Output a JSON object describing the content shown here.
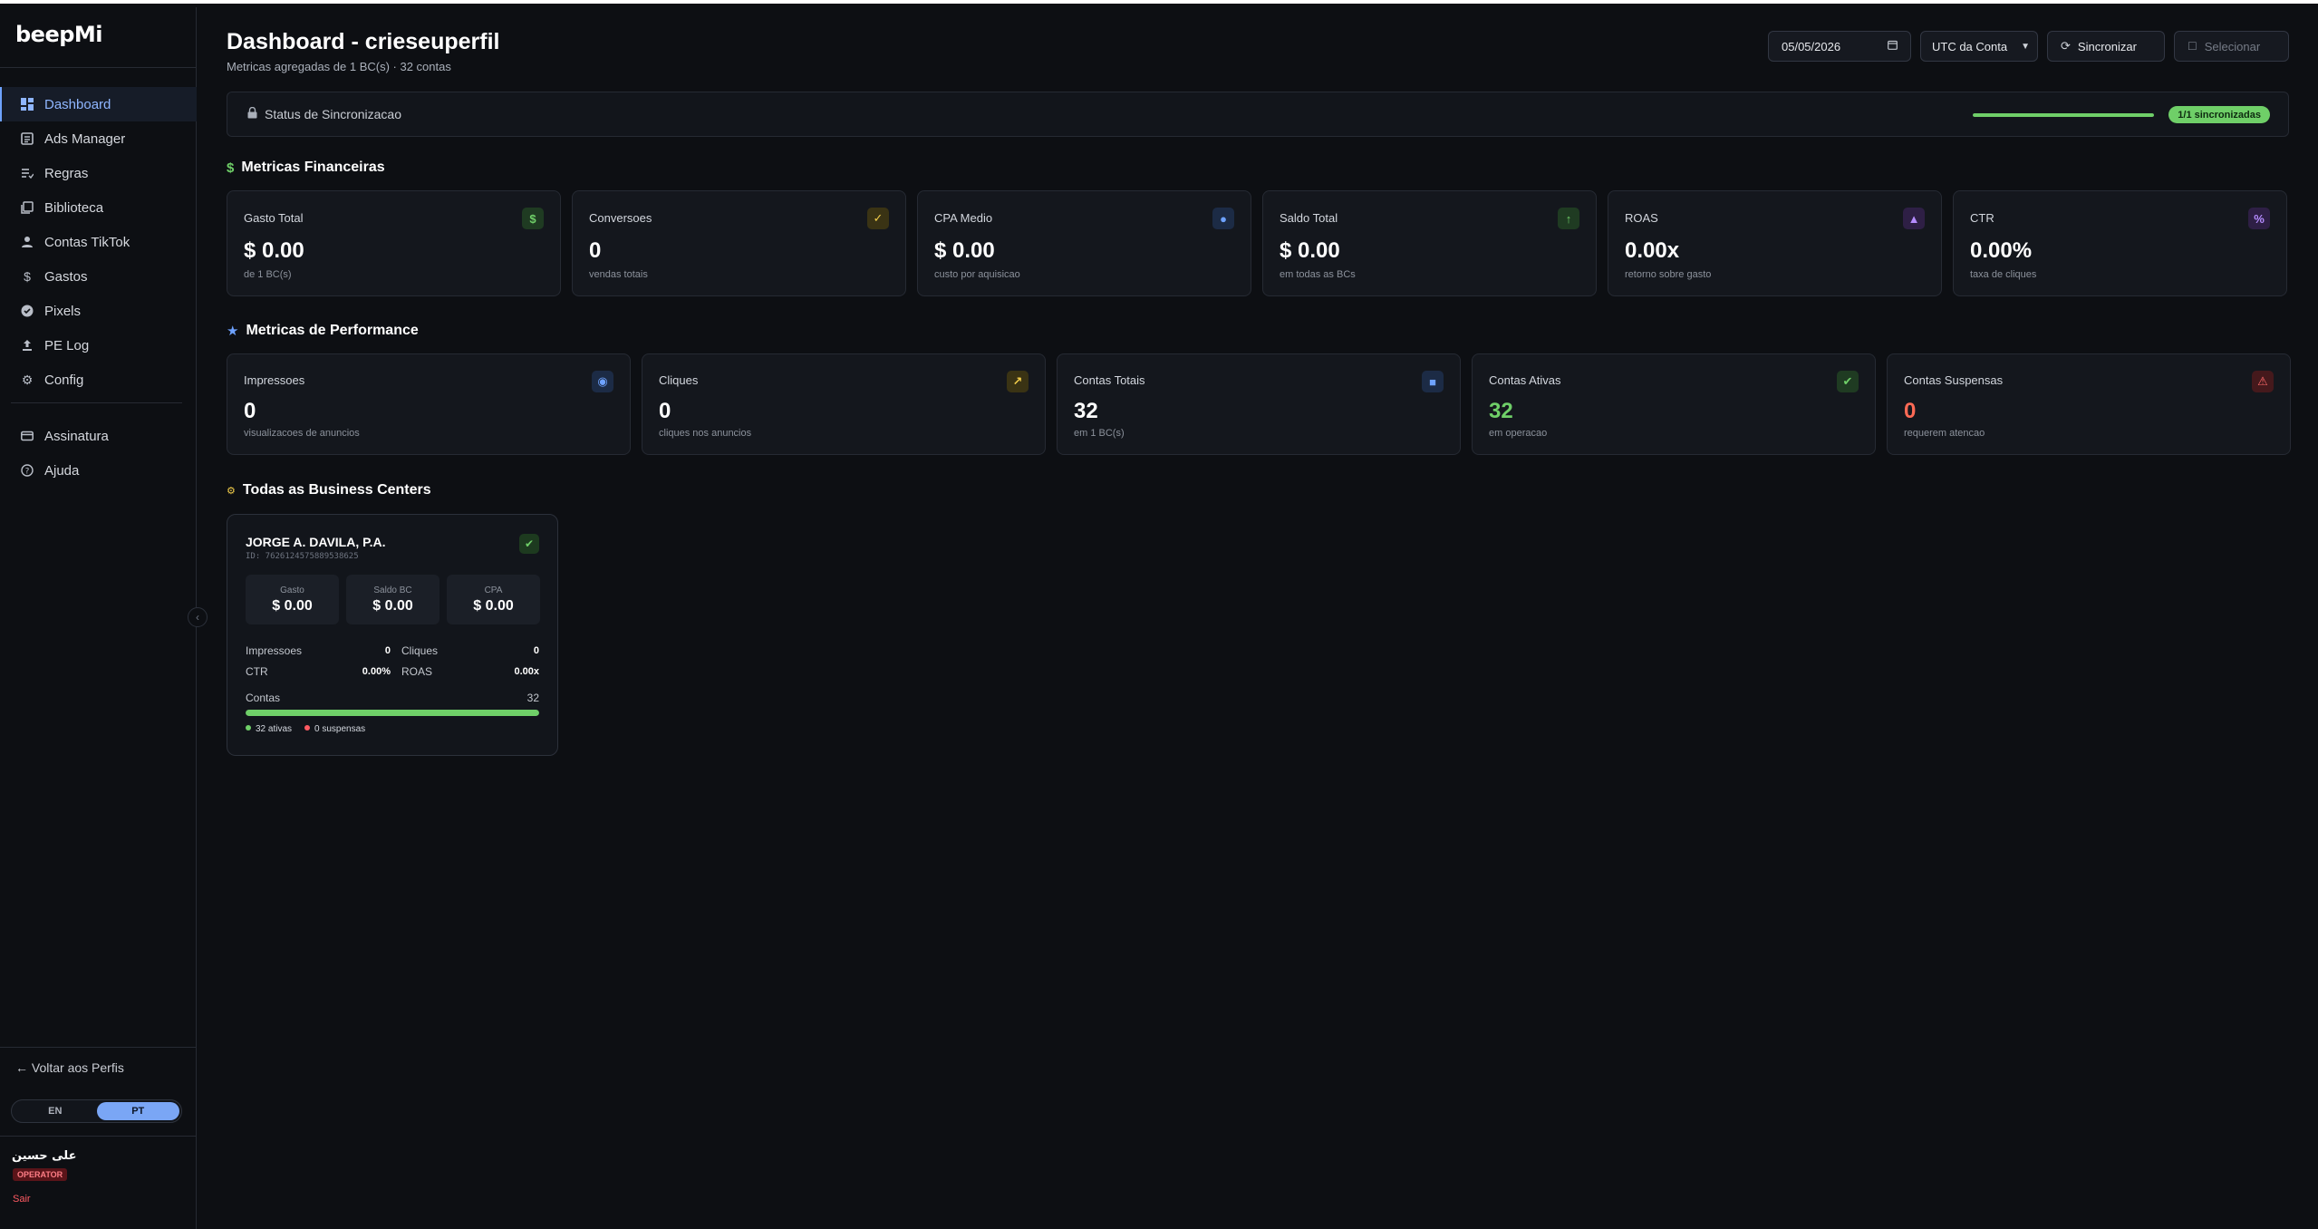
{
  "app": {
    "logo": "beepMi"
  },
  "sidebar": {
    "items": [
      {
        "label": "Dashboard",
        "icon": "dashboard-icon",
        "active": true
      },
      {
        "label": "Ads Manager",
        "icon": "ads-manager-icon"
      },
      {
        "label": "Regras",
        "icon": "rules-icon"
      },
      {
        "label": "Biblioteca",
        "icon": "library-icon"
      },
      {
        "label": "Contas TikTok",
        "icon": "person-icon"
      },
      {
        "label": "Gastos",
        "icon": "dollar-icon"
      },
      {
        "label": "Pixels",
        "icon": "check-circle-icon"
      },
      {
        "label": "PE Log",
        "icon": "upload-icon"
      },
      {
        "label": "Config",
        "icon": "gear-icon"
      }
    ],
    "secondary": [
      {
        "label": "Assinatura",
        "icon": "credit-card-icon"
      },
      {
        "label": "Ajuda",
        "icon": "help-icon"
      }
    ],
    "back_label": "← Voltar aos Perfis",
    "lang": {
      "en": "EN",
      "pt": "PT",
      "selected": "PT"
    },
    "user": {
      "name": "علی حسین",
      "role": "OPERATOR",
      "logout": "Sair"
    }
  },
  "header": {
    "title": "Dashboard - crieseuperfil",
    "subtitle": "Metricas agregadas de 1 BC(s) · 32 contas",
    "date_value": "05/05/2026",
    "timezone": "UTC da Conta",
    "sync_label": "Sincronizar",
    "select_label": "Selecionar"
  },
  "status": {
    "label": "Status de Sincronizacao",
    "progress": 1.0,
    "pill": "1/1 sincronizadas"
  },
  "financial": {
    "title": "Metricas Financeiras",
    "cards": [
      {
        "label": "Gasto Total",
        "value": "$ 0.00",
        "sub": "de 1 BC(s)",
        "icon": "dollar-icon",
        "glyph": "$",
        "bg": "#1f3b22",
        "fg": "#6fcf68"
      },
      {
        "label": "Conversoes",
        "value": "0",
        "sub": "vendas totais",
        "icon": "check-icon",
        "glyph": "✓",
        "bg": "#3a3314",
        "fg": "#f2cd4a"
      },
      {
        "label": "CPA Medio",
        "value": "$ 0.00",
        "sub": "custo por aquisicao",
        "icon": "circle-icon",
        "glyph": "●",
        "bg": "#1c2b45",
        "fg": "#6ea2ff"
      },
      {
        "label": "Saldo Total",
        "value": "$ 0.00",
        "sub": "em todas as BCs",
        "icon": "arrow-up-icon",
        "glyph": "↑",
        "bg": "#1f3b22",
        "fg": "#6fcf68"
      },
      {
        "label": "ROAS",
        "value": "0.00x",
        "sub": "retorno sobre gasto",
        "icon": "triangle-icon",
        "glyph": "▲",
        "bg": "#2e1f45",
        "fg": "#b58cff"
      },
      {
        "label": "CTR",
        "value": "0.00%",
        "sub": "taxa de cliques",
        "icon": "percent-icon",
        "glyph": "%",
        "bg": "#2e1f45",
        "fg": "#b58cff"
      }
    ]
  },
  "performance": {
    "title": "Metricas de Performance",
    "cards": [
      {
        "label": "Impressoes",
        "value": "0",
        "sub": "visualizacoes de anuncios",
        "icon": "eye-icon",
        "glyph": "◉",
        "bg": "#1c2b45",
        "fg": "#6ea2ff",
        "color": "#ffffff"
      },
      {
        "label": "Cliques",
        "value": "0",
        "sub": "cliques nos anuncios",
        "icon": "cursor-icon",
        "glyph": "↗",
        "bg": "#3a3314",
        "fg": "#f2cd4a",
        "color": "#ffffff"
      },
      {
        "label": "Contas Totais",
        "value": "32",
        "sub": "em 1 BC(s)",
        "icon": "square-icon",
        "glyph": "■",
        "bg": "#1c2b45",
        "fg": "#6ea2ff",
        "color": "#ffffff"
      },
      {
        "label": "Contas Ativas",
        "value": "32",
        "sub": "em operacao",
        "icon": "check-icon",
        "glyph": "✔",
        "bg": "#1f3b22",
        "fg": "#6fcf68",
        "color": "#6fcf68"
      },
      {
        "label": "Contas Suspensas",
        "value": "0",
        "sub": "requerem atencao",
        "icon": "warning-icon",
        "glyph": "⚠",
        "bg": "#45191c",
        "fg": "#ff6a6a",
        "color": "#ff6a55"
      }
    ]
  },
  "business_centers": {
    "title": "Todas as Business Centers",
    "items": [
      {
        "name": "JORGE A. DAVILA, P.A.",
        "id": "ID: 7626124575889538625",
        "gasto_label": "Gasto",
        "gasto": "$ 0.00",
        "saldo_label": "Saldo BC",
        "saldo": "$ 0.00",
        "cpa_label": "CPA",
        "cpa": "$ 0.00",
        "impressoes_label": "Impressoes",
        "impressoes": "0",
        "cliques_label": "Cliques",
        "cliques": "0",
        "ctr_label": "CTR",
        "ctr": "0.00%",
        "roas_label": "ROAS",
        "roas": "0.00x",
        "contas_label": "Contas",
        "contas": "32",
        "active_fraction": 1.0,
        "ativas": "32 ativas",
        "suspensas": "0 suspensas"
      }
    ]
  },
  "colors": {
    "accent": "#6ea2ff",
    "success": "#6fcf68",
    "danger": "#ff5a62",
    "warning": "#f2cd4a"
  }
}
